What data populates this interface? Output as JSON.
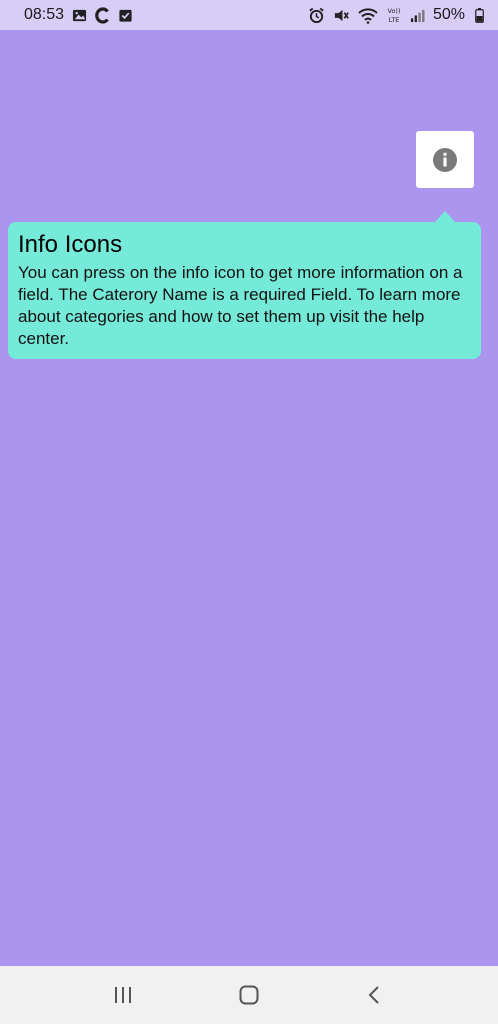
{
  "status_bar": {
    "time": "08:53",
    "battery": "50%",
    "left_icons": [
      "image-icon",
      "c-app-icon",
      "checkbox-icon"
    ],
    "right_icons": [
      "alarm-icon",
      "mute-icon",
      "wifi-icon",
      "volte-icon",
      "signal-icon",
      "battery-icon"
    ],
    "volte_label": "Vo)) LTE"
  },
  "tooltip": {
    "title": "Info Icons",
    "body": "You can press on the info icon to get more information on a field. The Caterory Name is a required Field. To learn more about categories and how to set them up visit the help center."
  },
  "colors": {
    "background": "#ab95ef",
    "status_bar": "#d7cdf7",
    "tooltip": "#75ead8",
    "info_icon": "#7a7a7a",
    "nav_bar": "#f1f1f1"
  },
  "nav_bar": {
    "buttons": [
      "recent-apps-icon",
      "home-icon",
      "back-icon"
    ]
  }
}
